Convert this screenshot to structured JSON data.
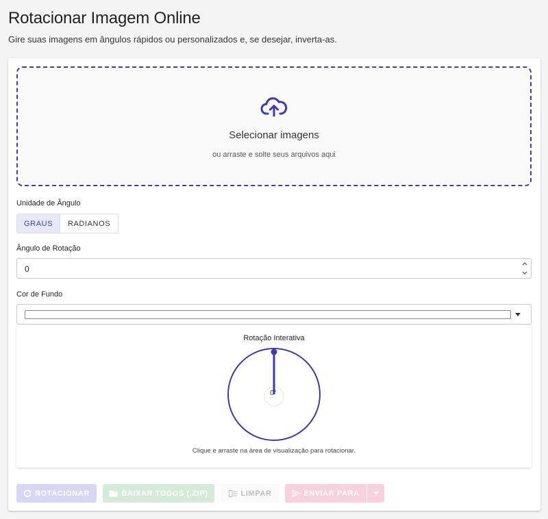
{
  "page": {
    "title": "Rotacionar Imagem Online",
    "subtitle": "Gire suas imagens em ângulos rápidos ou personalizados e, se desejar, inverta-as."
  },
  "dropzone": {
    "icon": "cloud-upload-icon",
    "title": "Selecionar imagens",
    "hint": "ou arraste e solte seus arquivos aqui"
  },
  "angle_unit": {
    "label": "Unidade de Ângulo",
    "options": [
      "GRAUS",
      "RADIANOS"
    ],
    "selected": "GRAUS"
  },
  "rotation_angle": {
    "label": "Ângulo de Rotação",
    "value": "0"
  },
  "background_color": {
    "label": "Cor de Fundo",
    "value": "#ffffff"
  },
  "interactive": {
    "title": "Rotação Interativa",
    "readout": "0°",
    "angle_deg": 0,
    "hint": "Clique e arraste na área de visualização para rotacionar."
  },
  "actions": {
    "rotate": "ROTACIONAR",
    "download_all": "BAIXAR TODOS (.ZIP)",
    "clear": "LIMPAR",
    "send_to": "ENVIAR PARA"
  },
  "colors": {
    "accent": "#3f39b5",
    "rotate_bg": "#d8d6f4",
    "download_bg": "#d4ecd7",
    "send_bg": "#f9d0dd"
  }
}
